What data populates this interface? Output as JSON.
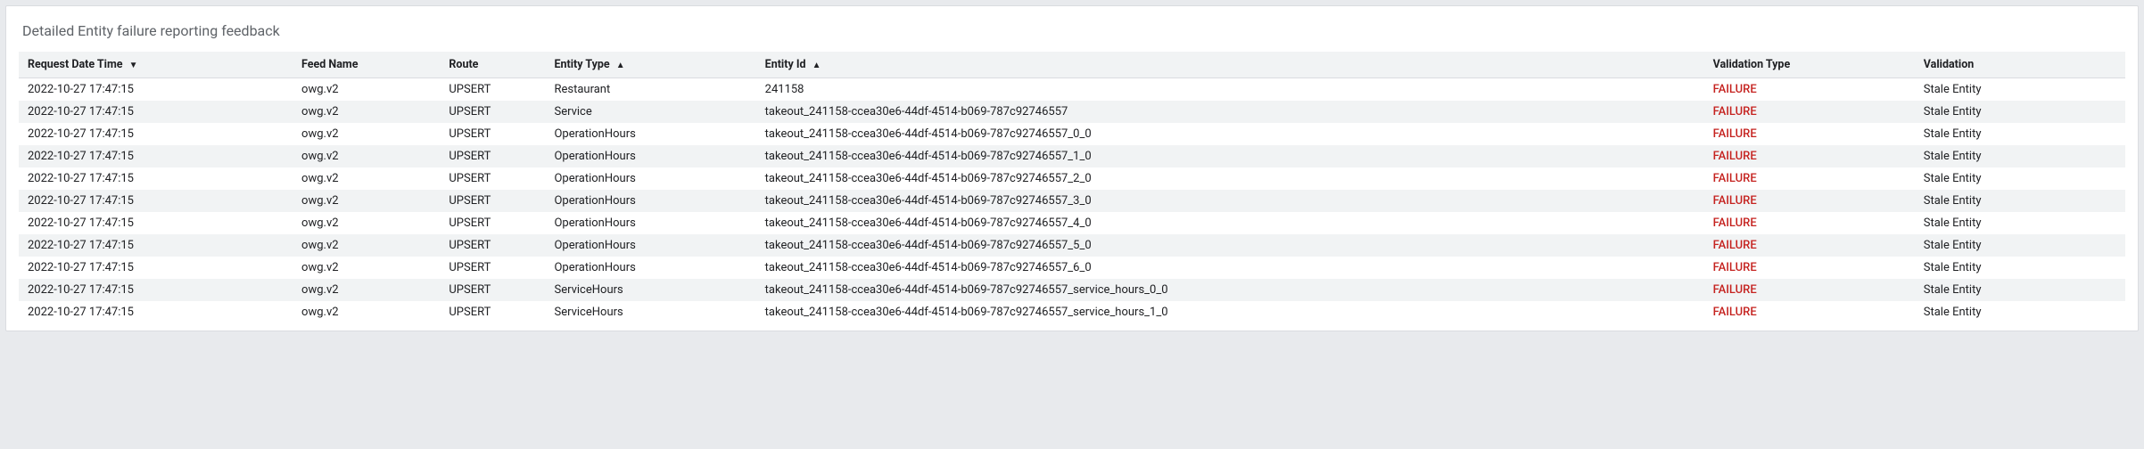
{
  "card": {
    "title": "Detailed Entity failure reporting feedback"
  },
  "table": {
    "columns": [
      {
        "label": "Request Date Time",
        "sort": "desc"
      },
      {
        "label": "Feed Name"
      },
      {
        "label": "Route"
      },
      {
        "label": "Entity Type",
        "sort": "asc"
      },
      {
        "label": "Entity Id",
        "sort": "asc"
      },
      {
        "label": "Validation Type"
      },
      {
        "label": "Validation"
      }
    ],
    "rows": [
      {
        "request_date_time": "2022-10-27 17:47:15",
        "feed_name": "owg.v2",
        "route": "UPSERT",
        "entity_type": "Restaurant",
        "entity_id": "241158",
        "validation_type": "FAILURE",
        "validation": "Stale Entity"
      },
      {
        "request_date_time": "2022-10-27 17:47:15",
        "feed_name": "owg.v2",
        "route": "UPSERT",
        "entity_type": "Service",
        "entity_id": "takeout_241158-ccea30e6-44df-4514-b069-787c92746557",
        "validation_type": "FAILURE",
        "validation": "Stale Entity"
      },
      {
        "request_date_time": "2022-10-27 17:47:15",
        "feed_name": "owg.v2",
        "route": "UPSERT",
        "entity_type": "OperationHours",
        "entity_id": "takeout_241158-ccea30e6-44df-4514-b069-787c92746557_0_0",
        "validation_type": "FAILURE",
        "validation": "Stale Entity"
      },
      {
        "request_date_time": "2022-10-27 17:47:15",
        "feed_name": "owg.v2",
        "route": "UPSERT",
        "entity_type": "OperationHours",
        "entity_id": "takeout_241158-ccea30e6-44df-4514-b069-787c92746557_1_0",
        "validation_type": "FAILURE",
        "validation": "Stale Entity"
      },
      {
        "request_date_time": "2022-10-27 17:47:15",
        "feed_name": "owg.v2",
        "route": "UPSERT",
        "entity_type": "OperationHours",
        "entity_id": "takeout_241158-ccea30e6-44df-4514-b069-787c92746557_2_0",
        "validation_type": "FAILURE",
        "validation": "Stale Entity"
      },
      {
        "request_date_time": "2022-10-27 17:47:15",
        "feed_name": "owg.v2",
        "route": "UPSERT",
        "entity_type": "OperationHours",
        "entity_id": "takeout_241158-ccea30e6-44df-4514-b069-787c92746557_3_0",
        "validation_type": "FAILURE",
        "validation": "Stale Entity"
      },
      {
        "request_date_time": "2022-10-27 17:47:15",
        "feed_name": "owg.v2",
        "route": "UPSERT",
        "entity_type": "OperationHours",
        "entity_id": "takeout_241158-ccea30e6-44df-4514-b069-787c92746557_4_0",
        "validation_type": "FAILURE",
        "validation": "Stale Entity"
      },
      {
        "request_date_time": "2022-10-27 17:47:15",
        "feed_name": "owg.v2",
        "route": "UPSERT",
        "entity_type": "OperationHours",
        "entity_id": "takeout_241158-ccea30e6-44df-4514-b069-787c92746557_5_0",
        "validation_type": "FAILURE",
        "validation": "Stale Entity"
      },
      {
        "request_date_time": "2022-10-27 17:47:15",
        "feed_name": "owg.v2",
        "route": "UPSERT",
        "entity_type": "OperationHours",
        "entity_id": "takeout_241158-ccea30e6-44df-4514-b069-787c92746557_6_0",
        "validation_type": "FAILURE",
        "validation": "Stale Entity"
      },
      {
        "request_date_time": "2022-10-27 17:47:15",
        "feed_name": "owg.v2",
        "route": "UPSERT",
        "entity_type": "ServiceHours",
        "entity_id": "takeout_241158-ccea30e6-44df-4514-b069-787c92746557_service_hours_0_0",
        "validation_type": "FAILURE",
        "validation": "Stale Entity"
      },
      {
        "request_date_time": "2022-10-27 17:47:15",
        "feed_name": "owg.v2",
        "route": "UPSERT",
        "entity_type": "ServiceHours",
        "entity_id": "takeout_241158-ccea30e6-44df-4514-b069-787c92746557_service_hours_1_0",
        "validation_type": "FAILURE",
        "validation": "Stale Entity"
      }
    ]
  }
}
